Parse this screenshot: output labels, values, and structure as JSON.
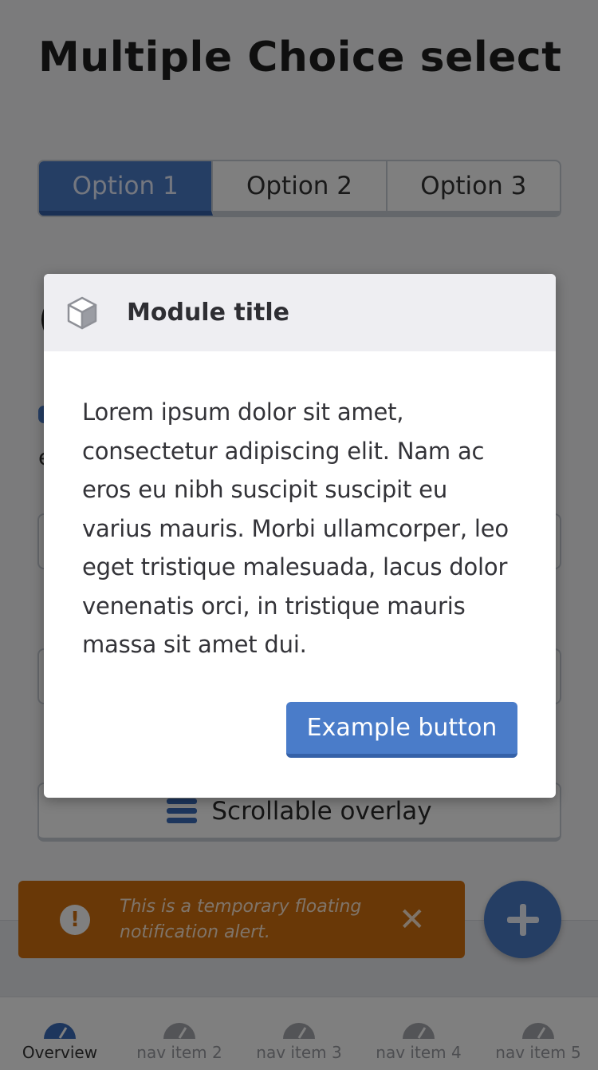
{
  "page": {
    "title": "Multiple Choice select",
    "segmented": {
      "options": [
        "Option 1",
        "Option 2",
        "Option 3"
      ],
      "selected": "Option 1"
    },
    "bg_heading_stub": "(",
    "bg_letter": "e",
    "scroll_button": {
      "label": "Scrollable overlay",
      "icon": "hamburger-icon"
    }
  },
  "modal": {
    "title": "Module title",
    "icon": "cube-icon",
    "body": "Lorem ipsum dolor sit amet, consectetur adipiscing elit. Nam ac eros eu nibh suscipit suscipit eu varius mauris. Morbi ullamcorper, leo eget tristique malesuada, lacus dolor venenatis orci, in tristique mauris massa sit amet dui.",
    "button_label": "Example button"
  },
  "alert": {
    "message": "This is a temporary floating notification alert.",
    "icon": "exclamation-icon",
    "close_icon": "close-icon"
  },
  "fab": {
    "icon": "plus-icon"
  },
  "tabbar": {
    "items": [
      {
        "label": "Overview",
        "icon": "gauge-icon"
      },
      {
        "label": "nav item 2",
        "icon": "gauge-icon"
      },
      {
        "label": "nav item 3",
        "icon": "gauge-icon"
      },
      {
        "label": "nav item 4",
        "icon": "gauge-icon"
      },
      {
        "label": "nav item 5",
        "icon": "gauge-icon"
      }
    ],
    "active": "Overview"
  },
  "colors": {
    "accent": "#4a7cc9",
    "accent_dark": "#3561a8",
    "alert": "#d2700f",
    "overlay": "rgba(0,0,0,0.5)"
  }
}
